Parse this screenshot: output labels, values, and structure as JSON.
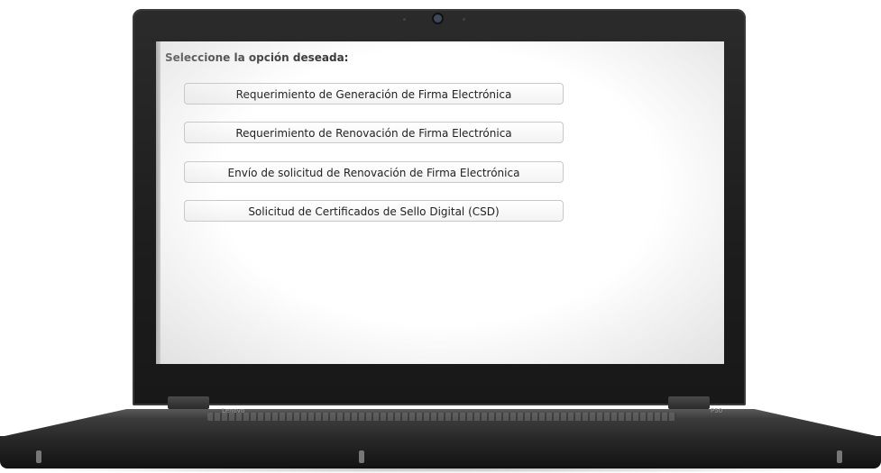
{
  "screen": {
    "heading": "Seleccione la opción deseada:",
    "options": [
      {
        "label": "Requerimiento de Generación de Firma Electrónica"
      },
      {
        "label": "Requerimiento de Renovación de Firma Electrónica"
      },
      {
        "label": "Envío de solicitud de Renovación de Firma Electrónica"
      },
      {
        "label": "Solicitud de Certificados de Sello Digital (CSD)"
      }
    ]
  },
  "laptop": {
    "brand_left": "Lenovo",
    "model_right": "P50"
  }
}
